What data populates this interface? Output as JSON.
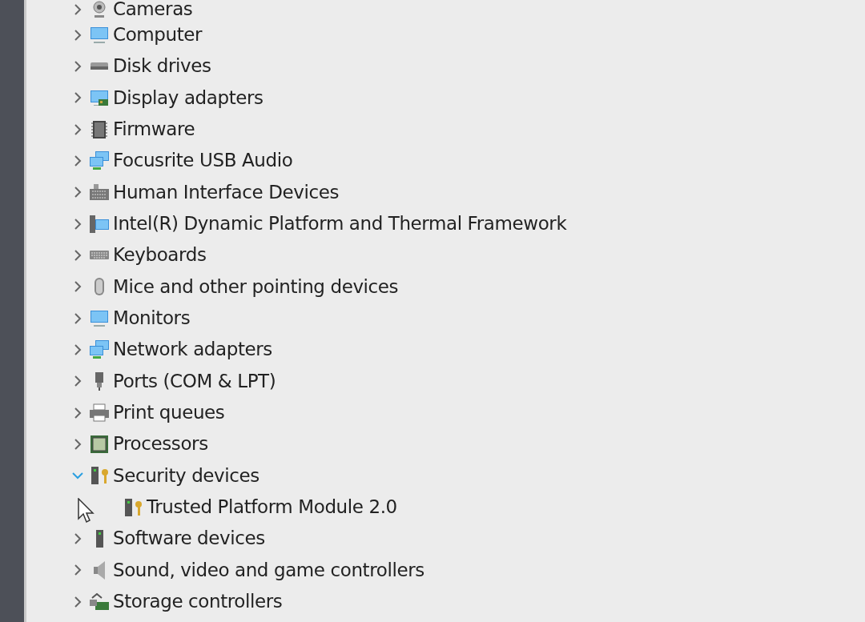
{
  "tree": {
    "items": [
      {
        "label": "Cameras",
        "expanded": false
      },
      {
        "label": "Computer",
        "expanded": false
      },
      {
        "label": "Disk drives",
        "expanded": false
      },
      {
        "label": "Display adapters",
        "expanded": false
      },
      {
        "label": "Firmware",
        "expanded": false
      },
      {
        "label": "Focusrite USB Audio",
        "expanded": false
      },
      {
        "label": "Human Interface Devices",
        "expanded": false
      },
      {
        "label": "Intel(R) Dynamic Platform and Thermal Framework",
        "expanded": false
      },
      {
        "label": "Keyboards",
        "expanded": false
      },
      {
        "label": "Mice and other pointing devices",
        "expanded": false
      },
      {
        "label": "Monitors",
        "expanded": false
      },
      {
        "label": "Network adapters",
        "expanded": false
      },
      {
        "label": "Ports (COM & LPT)",
        "expanded": false
      },
      {
        "label": "Print queues",
        "expanded": false
      },
      {
        "label": "Processors",
        "expanded": false
      },
      {
        "label": "Security devices",
        "expanded": true,
        "children": [
          {
            "label": "Trusted Platform Module 2.0"
          }
        ]
      },
      {
        "label": "Software devices",
        "expanded": false
      },
      {
        "label": "Sound, video and game controllers",
        "expanded": false
      },
      {
        "label": "Storage controllers",
        "expanded": false
      }
    ]
  }
}
